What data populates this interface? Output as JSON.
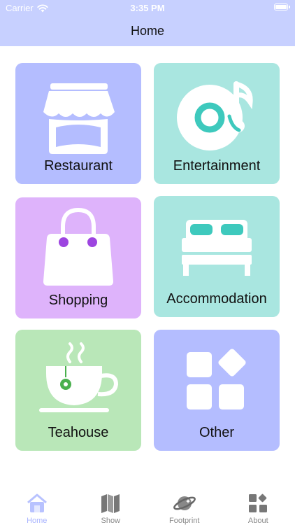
{
  "status": {
    "carrier": "Carrier",
    "time": "3:35 PM"
  },
  "nav": {
    "title": "Home"
  },
  "categories": [
    {
      "label": "Restaurant",
      "icon": "storefront-icon",
      "color": "#b4bdff"
    },
    {
      "label": "Entertainment",
      "icon": "music-disc-icon",
      "color": "#a9e6e0"
    },
    {
      "label": "Shopping",
      "icon": "shopping-bag-icon",
      "color": "#deb3fb"
    },
    {
      "label": "Accommodation",
      "icon": "bed-icon",
      "color": "#a9e6e0"
    },
    {
      "label": "Teahouse",
      "icon": "teacup-icon",
      "color": "#b9e7b8"
    },
    {
      "label": "Other",
      "icon": "grid-tiles-icon",
      "color": "#b4bdff"
    }
  ],
  "tabs": [
    {
      "label": "Home",
      "icon": "home-icon",
      "active": true
    },
    {
      "label": "Show",
      "icon": "map-icon",
      "active": false
    },
    {
      "label": "Footprint",
      "icon": "planet-icon",
      "active": false
    },
    {
      "label": "About",
      "icon": "apps-icon",
      "active": false
    }
  ]
}
